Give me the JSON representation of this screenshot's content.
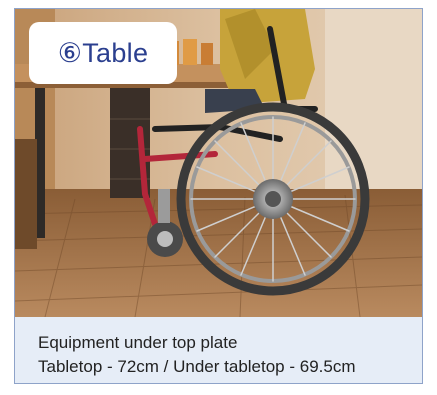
{
  "badge": {
    "label": "⑥Table"
  },
  "caption": {
    "line1": "Equipment under top plate",
    "line2": "Tabletop - 72cm / Under tabletop - 69.5cm"
  },
  "colors": {
    "badge_text": "#2b3f8f",
    "card_border": "#8ea3c9",
    "card_background": "#e6edf7",
    "caption_text": "#222222"
  },
  "photo": {
    "subject": "photo-wheelchair-under-table"
  }
}
